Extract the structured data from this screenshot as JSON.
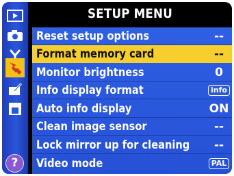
{
  "menu_title": "SETUP MENU",
  "tabs": [
    {
      "icon": "playback-icon",
      "active": false
    },
    {
      "icon": "camera-icon",
      "active": false
    },
    {
      "icon": "custom-settings-icon",
      "active": false
    },
    {
      "icon": "setup-wrench-icon",
      "active": true
    },
    {
      "icon": "retouch-icon",
      "active": false
    },
    {
      "icon": "my-menu-icon",
      "active": false
    }
  ],
  "help_symbol": "?",
  "items": [
    {
      "label": "Reset setup options",
      "value": "--"
    },
    {
      "label": "Format memory card",
      "value": "--",
      "selected": true
    },
    {
      "label": "Monitor brightness",
      "value": "0"
    },
    {
      "label": "Info display format",
      "value": "info",
      "boxed": true
    },
    {
      "label": "Auto info display",
      "value": "ON"
    },
    {
      "label": "Clean image sensor",
      "value": "--"
    },
    {
      "label": "Lock mirror up for cleaning",
      "value": "--"
    },
    {
      "label": "Video mode",
      "value": "PAL",
      "boxed": true
    }
  ],
  "colors": {
    "sidebar": "#2a56dc",
    "list_bg": "#2f5fe2",
    "highlight": "#f6cf2e",
    "help": "#8a58cf"
  }
}
